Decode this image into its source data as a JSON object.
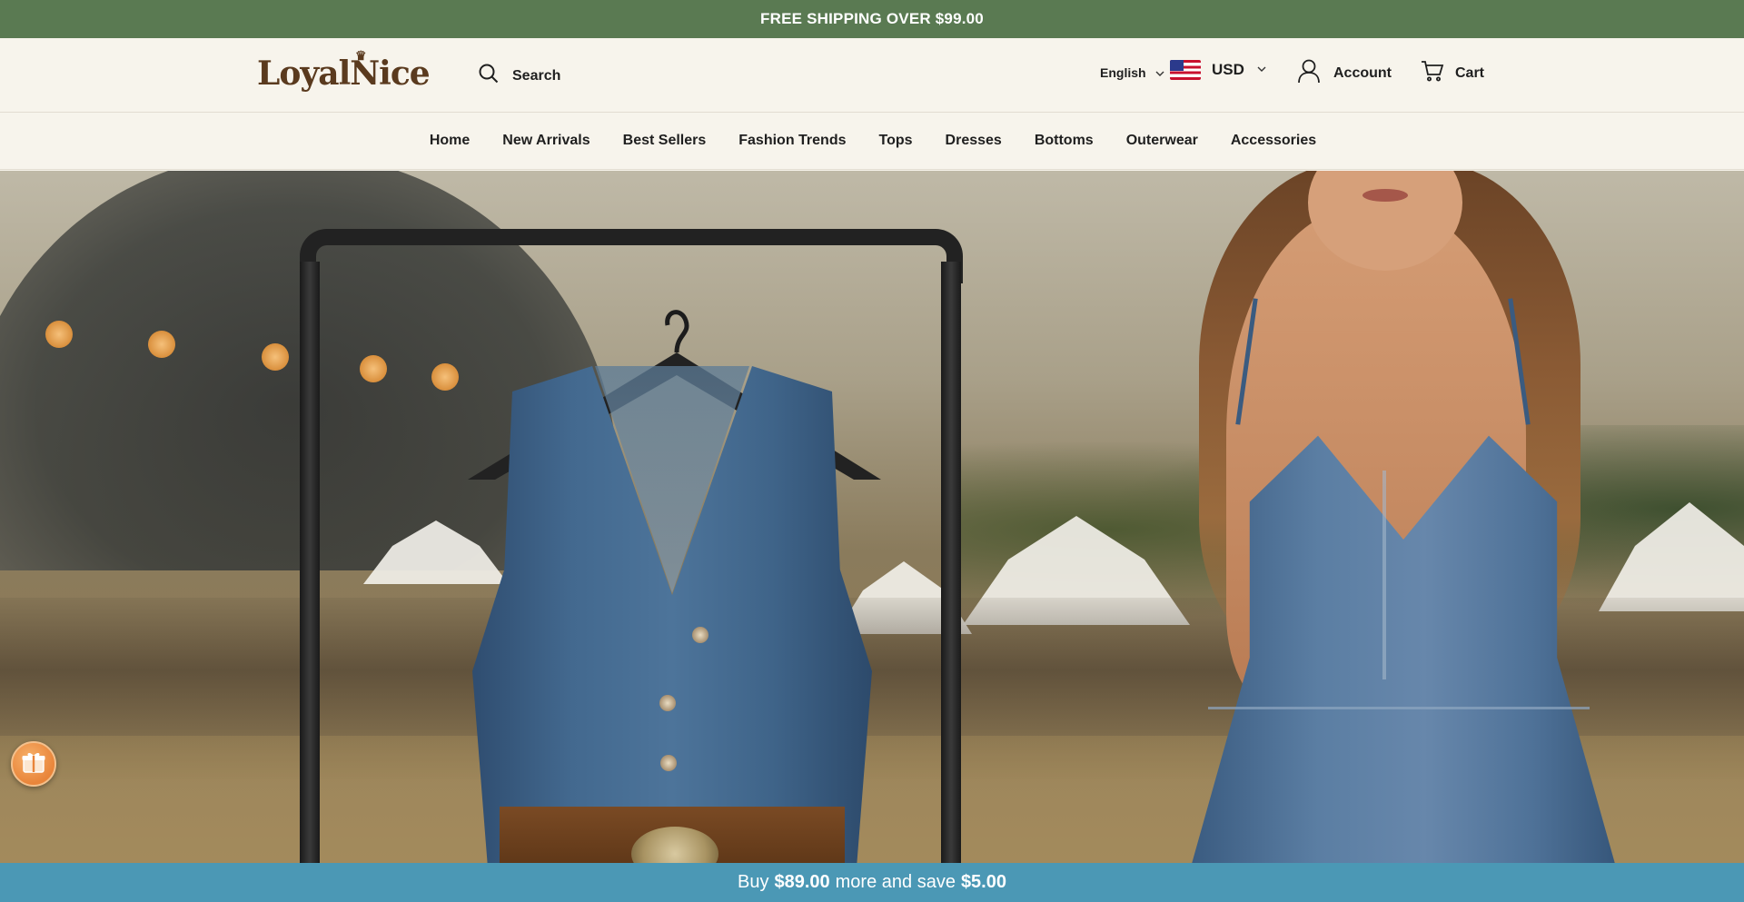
{
  "announcement": {
    "text": "FREE SHIPPING OVER $99.00"
  },
  "header": {
    "logo_text": "LoyalNice",
    "search_label": "Search",
    "language": "English",
    "currency": "USD",
    "account_label": "Account",
    "cart_label": "Cart"
  },
  "nav": {
    "items": [
      {
        "label": "Home"
      },
      {
        "label": "New Arrivals"
      },
      {
        "label": "Best Sellers"
      },
      {
        "label": "Fashion Trends"
      },
      {
        "label": "Tops"
      },
      {
        "label": "Dresses"
      },
      {
        "label": "Bottoms"
      },
      {
        "label": "Outerwear"
      },
      {
        "label": "Accessories"
      }
    ]
  },
  "promo_bar": {
    "prefix": "Buy",
    "amount": "$89.00",
    "middle": "more and save",
    "savings": "$5.00"
  },
  "icons": {
    "search": "search-icon",
    "account": "user-icon",
    "cart": "cart-icon",
    "gift": "gift-icon",
    "flag": "us-flag-icon"
  },
  "colors": {
    "announcement_bg": "#5a7a52",
    "header_bg": "#f7f4ec",
    "promo_bg": "#4b98b5",
    "logo": "#5a3a1e",
    "gift_button": "#e9853a"
  }
}
